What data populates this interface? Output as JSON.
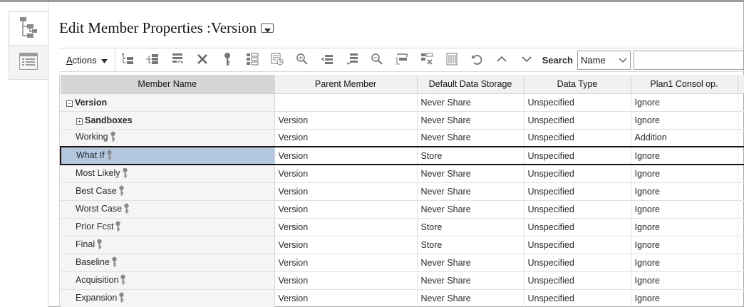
{
  "page": {
    "title": "Edit Member Properties :Version"
  },
  "rail": {
    "tabs": [
      {
        "icon": "hierarchy-icon"
      },
      {
        "icon": "list-icon"
      }
    ]
  },
  "toolbar": {
    "actions_label_first": "A",
    "actions_label_rest": "ctions",
    "search_label": "Search",
    "search_field_value": "Name",
    "search_input_value": "",
    "icons": [
      "add-child-icon",
      "add-sibling-icon",
      "add-shared-icon",
      "delete-icon",
      "key-icon",
      "tree-view-icon",
      "refresh-list-icon",
      "zoom-in-icon",
      "move-up-icon",
      "move-down-icon",
      "zoom-out-icon",
      "collapse-icon",
      "remove-icon",
      "grid-icon",
      "undo-icon",
      "move-up-arrow-icon",
      "move-down-arrow-icon"
    ]
  },
  "grid": {
    "columns": [
      "Member Name",
      "Parent Member",
      "Default Data Storage",
      "Data Type",
      "Plan1 Consol op."
    ],
    "rows": [
      {
        "name": "Version",
        "parent": "",
        "storage": "Never Share",
        "type": "Unspecified",
        "consol": "Ignore",
        "expander": "−",
        "bold": true,
        "indent": 0,
        "key": false
      },
      {
        "name": "Sandboxes",
        "parent": "Version",
        "storage": "Never Share",
        "type": "Unspecified",
        "consol": "Ignore",
        "expander": "+",
        "bold": true,
        "indent": 1,
        "key": false
      },
      {
        "name": "Working",
        "parent": "Version",
        "storage": "Never Share",
        "type": "Unspecified",
        "consol": "Addition",
        "expander": "",
        "bold": false,
        "indent": 1,
        "key": true
      },
      {
        "name": "What If",
        "parent": "Version",
        "storage": "Store",
        "type": "Unspecified",
        "consol": "Ignore",
        "expander": "",
        "bold": false,
        "indent": 1,
        "key": true,
        "selected": true
      },
      {
        "name": "Most Likely",
        "parent": "Version",
        "storage": "Never Share",
        "type": "Unspecified",
        "consol": "Ignore",
        "expander": "",
        "bold": false,
        "indent": 1,
        "key": true
      },
      {
        "name": "Best Case",
        "parent": "Version",
        "storage": "Never Share",
        "type": "Unspecified",
        "consol": "Ignore",
        "expander": "",
        "bold": false,
        "indent": 1,
        "key": true
      },
      {
        "name": "Worst Case",
        "parent": "Version",
        "storage": "Never Share",
        "type": "Unspecified",
        "consol": "Ignore",
        "expander": "",
        "bold": false,
        "indent": 1,
        "key": true
      },
      {
        "name": "Prior Fcst",
        "parent": "Version",
        "storage": "Store",
        "type": "Unspecified",
        "consol": "Ignore",
        "expander": "",
        "bold": false,
        "indent": 1,
        "key": true
      },
      {
        "name": "Final",
        "parent": "Version",
        "storage": "Store",
        "type": "Unspecified",
        "consol": "Ignore",
        "expander": "",
        "bold": false,
        "indent": 1,
        "key": true
      },
      {
        "name": "Baseline",
        "parent": "Version",
        "storage": "Never Share",
        "type": "Unspecified",
        "consol": "Ignore",
        "expander": "",
        "bold": false,
        "indent": 1,
        "key": true
      },
      {
        "name": "Acquisition",
        "parent": "Version",
        "storage": "Never Share",
        "type": "Unspecified",
        "consol": "Ignore",
        "expander": "",
        "bold": false,
        "indent": 1,
        "key": true
      },
      {
        "name": "Expansion",
        "parent": "Version",
        "storage": "Never Share",
        "type": "Unspecified",
        "consol": "Ignore",
        "expander": "",
        "bold": false,
        "indent": 1,
        "key": true
      }
    ]
  },
  "colors": {
    "selected_row": "#b3c7de",
    "header_bg": "#f1f1f1",
    "name_col_bg": "#f5f5f5"
  }
}
